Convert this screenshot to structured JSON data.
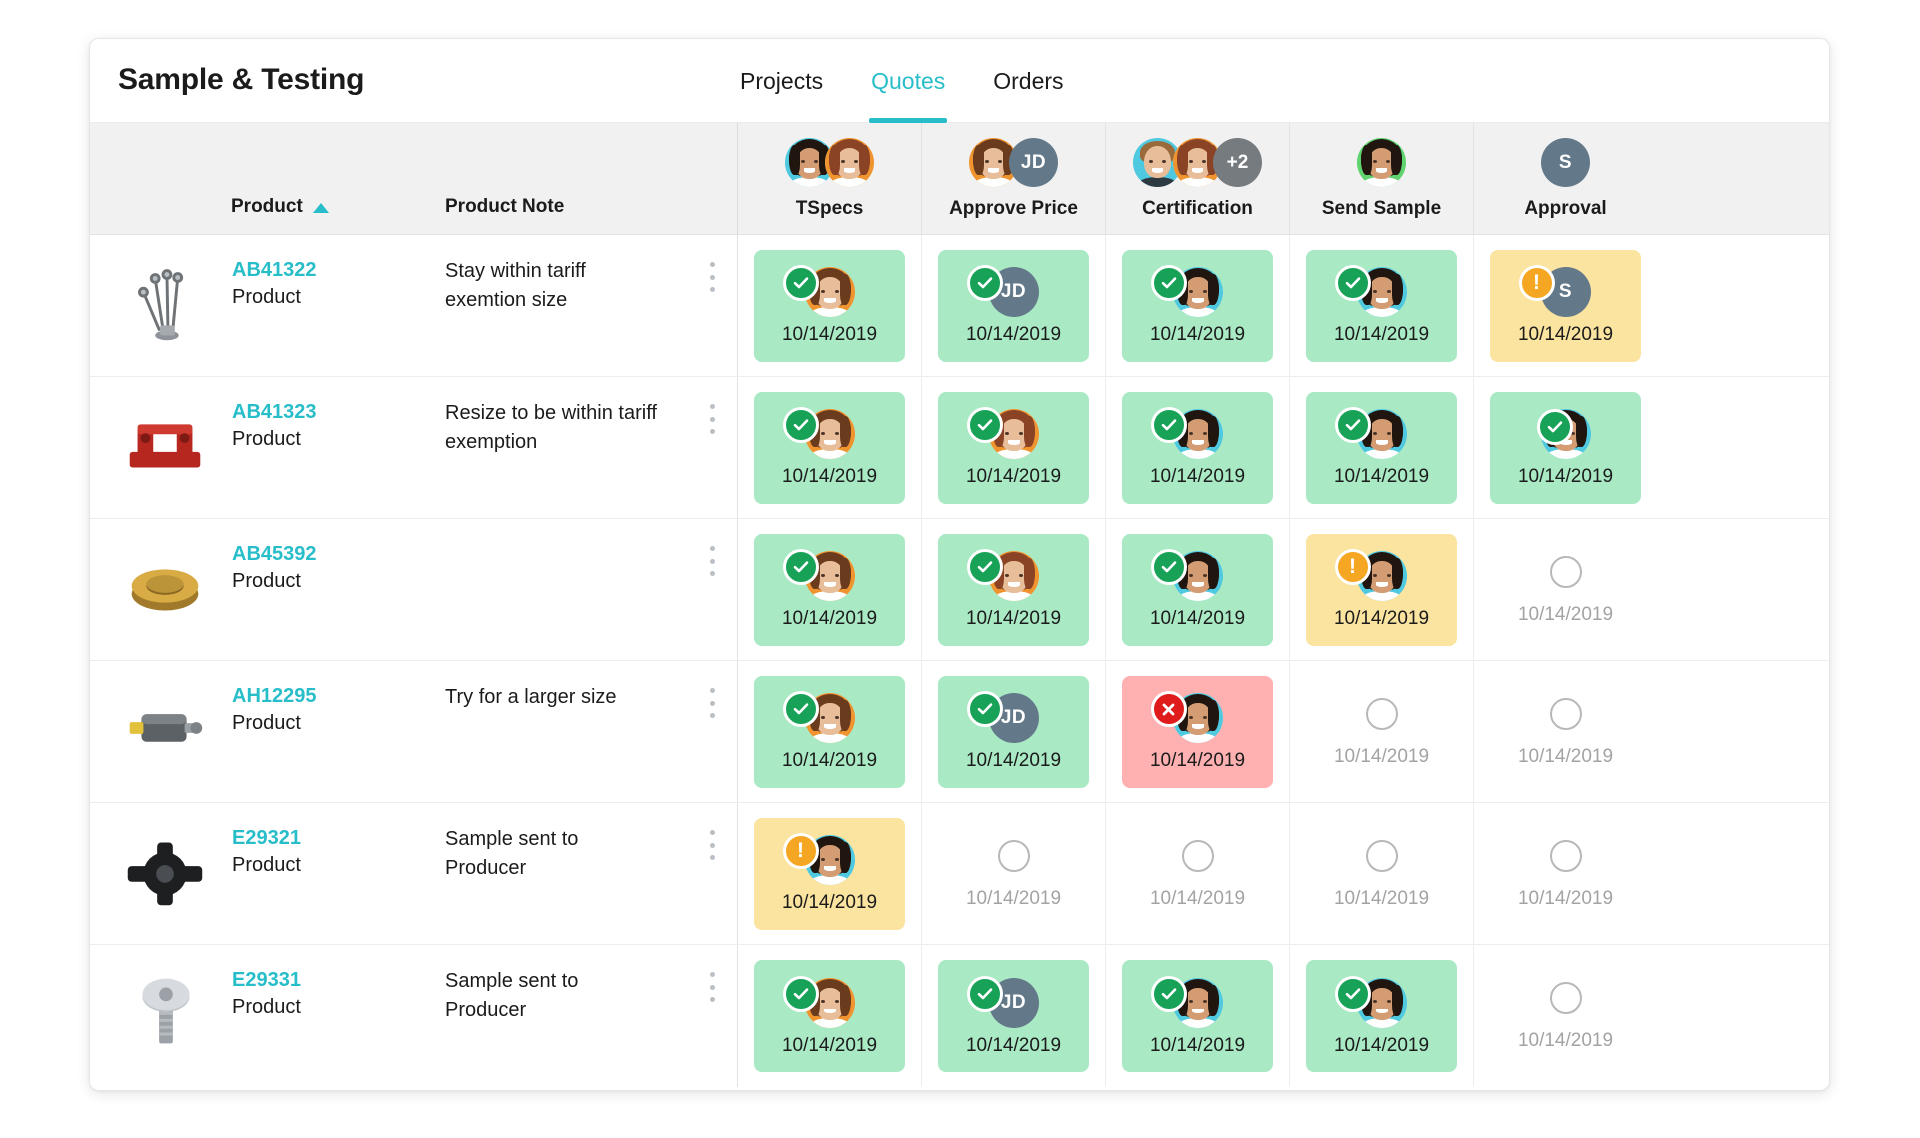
{
  "header": {
    "title": "Sample & Testing",
    "tabs": [
      {
        "label": "Projects",
        "active": false
      },
      {
        "label": "Quotes",
        "active": true
      },
      {
        "label": "Orders",
        "active": false
      }
    ]
  },
  "colors": {
    "accent": "#27bdc9",
    "done_bg": "#a9e9c4",
    "warn_bg": "#fbe3a0",
    "error_bg": "#ffb1b1",
    "badge_ok": "#17a258",
    "badge_alert": "#f5a623",
    "badge_error": "#e01b1b",
    "initials_avatar": "#63798a",
    "more_avatar": "#767b80",
    "header_bg": "#f1f1f1",
    "empty_text": "#a3a3a3"
  },
  "table": {
    "columns": {
      "product": {
        "label": "Product",
        "sort": "asc",
        "sort_icon": "triangle-up-icon"
      },
      "note": {
        "label": "Product Note"
      },
      "statuses": [
        {
          "key": "tspecs",
          "label": "TSpecs",
          "avatars": [
            {
              "type": "photo",
              "ring": "teal",
              "hair": "dark",
              "skin": "med",
              "body": "white"
            },
            {
              "type": "photo",
              "ring": "orange",
              "hair": "aub",
              "skin": "light",
              "body": "white"
            }
          ]
        },
        {
          "key": "approve_price",
          "label": "Approve Price",
          "avatars": [
            {
              "type": "photo",
              "ring": "orange",
              "hair": "brown",
              "skin": "light",
              "body": "white"
            },
            {
              "type": "initials",
              "text": "JD"
            }
          ]
        },
        {
          "key": "certification",
          "label": "Certification",
          "avatars": [
            {
              "type": "photo",
              "ring": "teal",
              "hair": "lbrown",
              "skin": "light",
              "body": "dark",
              "male": true
            },
            {
              "type": "photo",
              "ring": "orange",
              "hair": "aub",
              "skin": "light",
              "body": "white"
            },
            {
              "type": "more",
              "text": "+2"
            }
          ]
        },
        {
          "key": "send_sample",
          "label": "Send Sample",
          "avatars": [
            {
              "type": "photo",
              "ring": "green",
              "hair": "dark",
              "skin": "med",
              "body": "white"
            }
          ]
        },
        {
          "key": "approval",
          "label": "Approval",
          "avatars": [
            {
              "type": "initials",
              "text": "S"
            }
          ]
        }
      ]
    },
    "rows": [
      {
        "product_id": "AB41322",
        "product_sub": "Product",
        "note": "Stay within tariff exemtion size",
        "thumb": "robot-gripper-icon",
        "cells": [
          {
            "state": "done",
            "badge": "check-icon",
            "date": "10/14/2019",
            "avatar": {
              "type": "photo",
              "ring": "orange",
              "hair": "brown",
              "skin": "light",
              "body": "white"
            }
          },
          {
            "state": "done",
            "badge": "check-icon",
            "date": "10/14/2019",
            "avatar": {
              "type": "initials",
              "text": "JD"
            }
          },
          {
            "state": "done",
            "badge": "check-icon",
            "date": "10/14/2019",
            "avatar": {
              "type": "photo",
              "ring": "teal",
              "hair": "dark",
              "skin": "med",
              "body": "white"
            }
          },
          {
            "state": "done",
            "badge": "check-icon",
            "date": "10/14/2019",
            "avatar": {
              "type": "photo",
              "ring": "teal",
              "hair": "dark",
              "skin": "med",
              "body": "white"
            }
          },
          {
            "state": "warn",
            "badge": "alert-icon",
            "date": "10/14/2019",
            "avatar": {
              "type": "initials",
              "text": "S"
            }
          }
        ]
      },
      {
        "product_id": "AB41323",
        "product_sub": "Product",
        "note": "Resize to be within tariff exemption",
        "thumb": "red-bracket-icon",
        "cells": [
          {
            "state": "done",
            "badge": "check-icon",
            "date": "10/14/2019",
            "avatar": {
              "type": "photo",
              "ring": "orange",
              "hair": "brown",
              "skin": "light",
              "body": "white"
            }
          },
          {
            "state": "done",
            "badge": "check-icon",
            "date": "10/14/2019",
            "avatar": {
              "type": "photo",
              "ring": "orange",
              "hair": "aub",
              "skin": "light",
              "body": "white"
            }
          },
          {
            "state": "done",
            "badge": "check-icon",
            "date": "10/14/2019",
            "avatar": {
              "type": "photo",
              "ring": "teal",
              "hair": "dark",
              "skin": "med",
              "body": "white"
            }
          },
          {
            "state": "done",
            "badge": "check-icon",
            "date": "10/14/2019",
            "avatar": {
              "type": "photo",
              "ring": "teal",
              "hair": "dark",
              "skin": "med",
              "body": "white"
            }
          },
          {
            "state": "done",
            "badge": "check-icon",
            "badge_behind": true,
            "date": "10/14/2019",
            "avatar": {
              "type": "photo",
              "ring": "teal",
              "hair": "dark",
              "skin": "med",
              "body": "white"
            }
          }
        ]
      },
      {
        "product_id": "AB45392",
        "product_sub": "Product",
        "note": "",
        "thumb": "brass-gear-icon",
        "cells": [
          {
            "state": "done",
            "badge": "check-icon",
            "date": "10/14/2019",
            "avatar": {
              "type": "photo",
              "ring": "orange",
              "hair": "brown",
              "skin": "light",
              "body": "white"
            }
          },
          {
            "state": "done",
            "badge": "check-icon",
            "date": "10/14/2019",
            "avatar": {
              "type": "photo",
              "ring": "orange",
              "hair": "aub",
              "skin": "light",
              "body": "white"
            }
          },
          {
            "state": "done",
            "badge": "check-icon",
            "date": "10/14/2019",
            "avatar": {
              "type": "photo",
              "ring": "teal",
              "hair": "dark",
              "skin": "med",
              "body": "white"
            }
          },
          {
            "state": "warn",
            "badge": "alert-icon",
            "date": "10/14/2019",
            "avatar": {
              "type": "photo",
              "ring": "teal",
              "hair": "dark",
              "skin": "med",
              "body": "white"
            }
          },
          {
            "state": "empty",
            "badge": "empty-circle-icon",
            "date": "10/14/2019"
          }
        ]
      },
      {
        "product_id": "AH12295",
        "product_sub": "Product",
        "note": "Try for a larger size",
        "thumb": "dc-motor-icon",
        "cells": [
          {
            "state": "done",
            "badge": "check-icon",
            "date": "10/14/2019",
            "avatar": {
              "type": "photo",
              "ring": "orange",
              "hair": "brown",
              "skin": "light",
              "body": "white"
            }
          },
          {
            "state": "done",
            "badge": "check-icon",
            "date": "10/14/2019",
            "avatar": {
              "type": "initials",
              "text": "JD"
            }
          },
          {
            "state": "error",
            "badge": "x-icon",
            "date": "10/14/2019",
            "avatar": {
              "type": "photo",
              "ring": "teal",
              "hair": "dark",
              "skin": "med",
              "body": "white"
            }
          },
          {
            "state": "empty",
            "badge": "empty-circle-icon",
            "date": "10/14/2019"
          },
          {
            "state": "empty",
            "badge": "empty-circle-icon",
            "date": "10/14/2019"
          }
        ]
      },
      {
        "product_id": "E29321",
        "product_sub": "Product",
        "note": "Sample sent to Producer",
        "thumb": "black-hub-icon",
        "cells": [
          {
            "state": "warn",
            "badge": "alert-icon",
            "date": "10/14/2019",
            "avatar": {
              "type": "photo",
              "ring": "teal",
              "hair": "dark",
              "skin": "med",
              "body": "white"
            }
          },
          {
            "state": "empty",
            "badge": "empty-circle-icon",
            "date": "10/14/2019"
          },
          {
            "state": "empty",
            "badge": "empty-circle-icon",
            "date": "10/14/2019"
          },
          {
            "state": "empty",
            "badge": "empty-circle-icon",
            "date": "10/14/2019"
          },
          {
            "state": "empty",
            "badge": "empty-circle-icon",
            "date": "10/14/2019"
          }
        ]
      },
      {
        "product_id": "E29331",
        "product_sub": "Product",
        "note": "Sample sent to Producer",
        "thumb": "hex-bolt-icon",
        "cells": [
          {
            "state": "done",
            "badge": "check-icon",
            "date": "10/14/2019",
            "avatar": {
              "type": "photo",
              "ring": "orange",
              "hair": "brown",
              "skin": "light",
              "body": "white"
            }
          },
          {
            "state": "done",
            "badge": "check-icon",
            "date": "10/14/2019",
            "avatar": {
              "type": "initials",
              "text": "JD"
            }
          },
          {
            "state": "done",
            "badge": "check-icon",
            "date": "10/14/2019",
            "avatar": {
              "type": "photo",
              "ring": "teal",
              "hair": "dark",
              "skin": "med",
              "body": "white"
            }
          },
          {
            "state": "done",
            "badge": "check-icon",
            "date": "10/14/2019",
            "avatar": {
              "type": "photo",
              "ring": "teal",
              "hair": "dark",
              "skin": "med",
              "body": "white"
            }
          },
          {
            "state": "empty",
            "badge": "empty-circle-icon",
            "date": "10/14/2019"
          }
        ]
      }
    ]
  }
}
